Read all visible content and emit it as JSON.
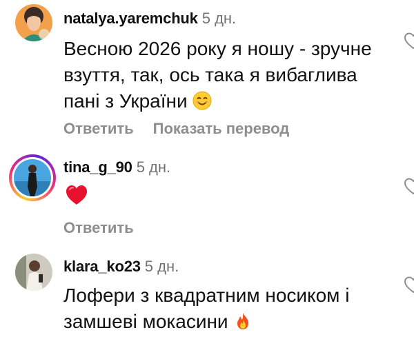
{
  "comments": [
    {
      "username": "natalya.yaremchuk",
      "time": "5 дн.",
      "text": "Весною 2026 року я ношу - зручне взуття, так, ось така я вибаглива пані з України",
      "emoji": "smiling-face-icon",
      "actions": {
        "reply": "Ответить",
        "translate": "Показать перевод"
      }
    },
    {
      "username": "tina_g_90",
      "time": "5 дн.",
      "emoji": "red-heart-icon",
      "actions": {
        "reply": "Ответить"
      }
    },
    {
      "username": "klara_ko23",
      "time": "5 дн.",
      "text": "Лофери з квадратним носиком і замшеві мокасини",
      "emoji": "fire-icon"
    }
  ],
  "colors": {
    "username": "#111111",
    "meta": "#737373",
    "action": "#8e8e8e",
    "story_ring": [
      "#f9ce34",
      "#ee2a7b",
      "#6228d7"
    ]
  }
}
